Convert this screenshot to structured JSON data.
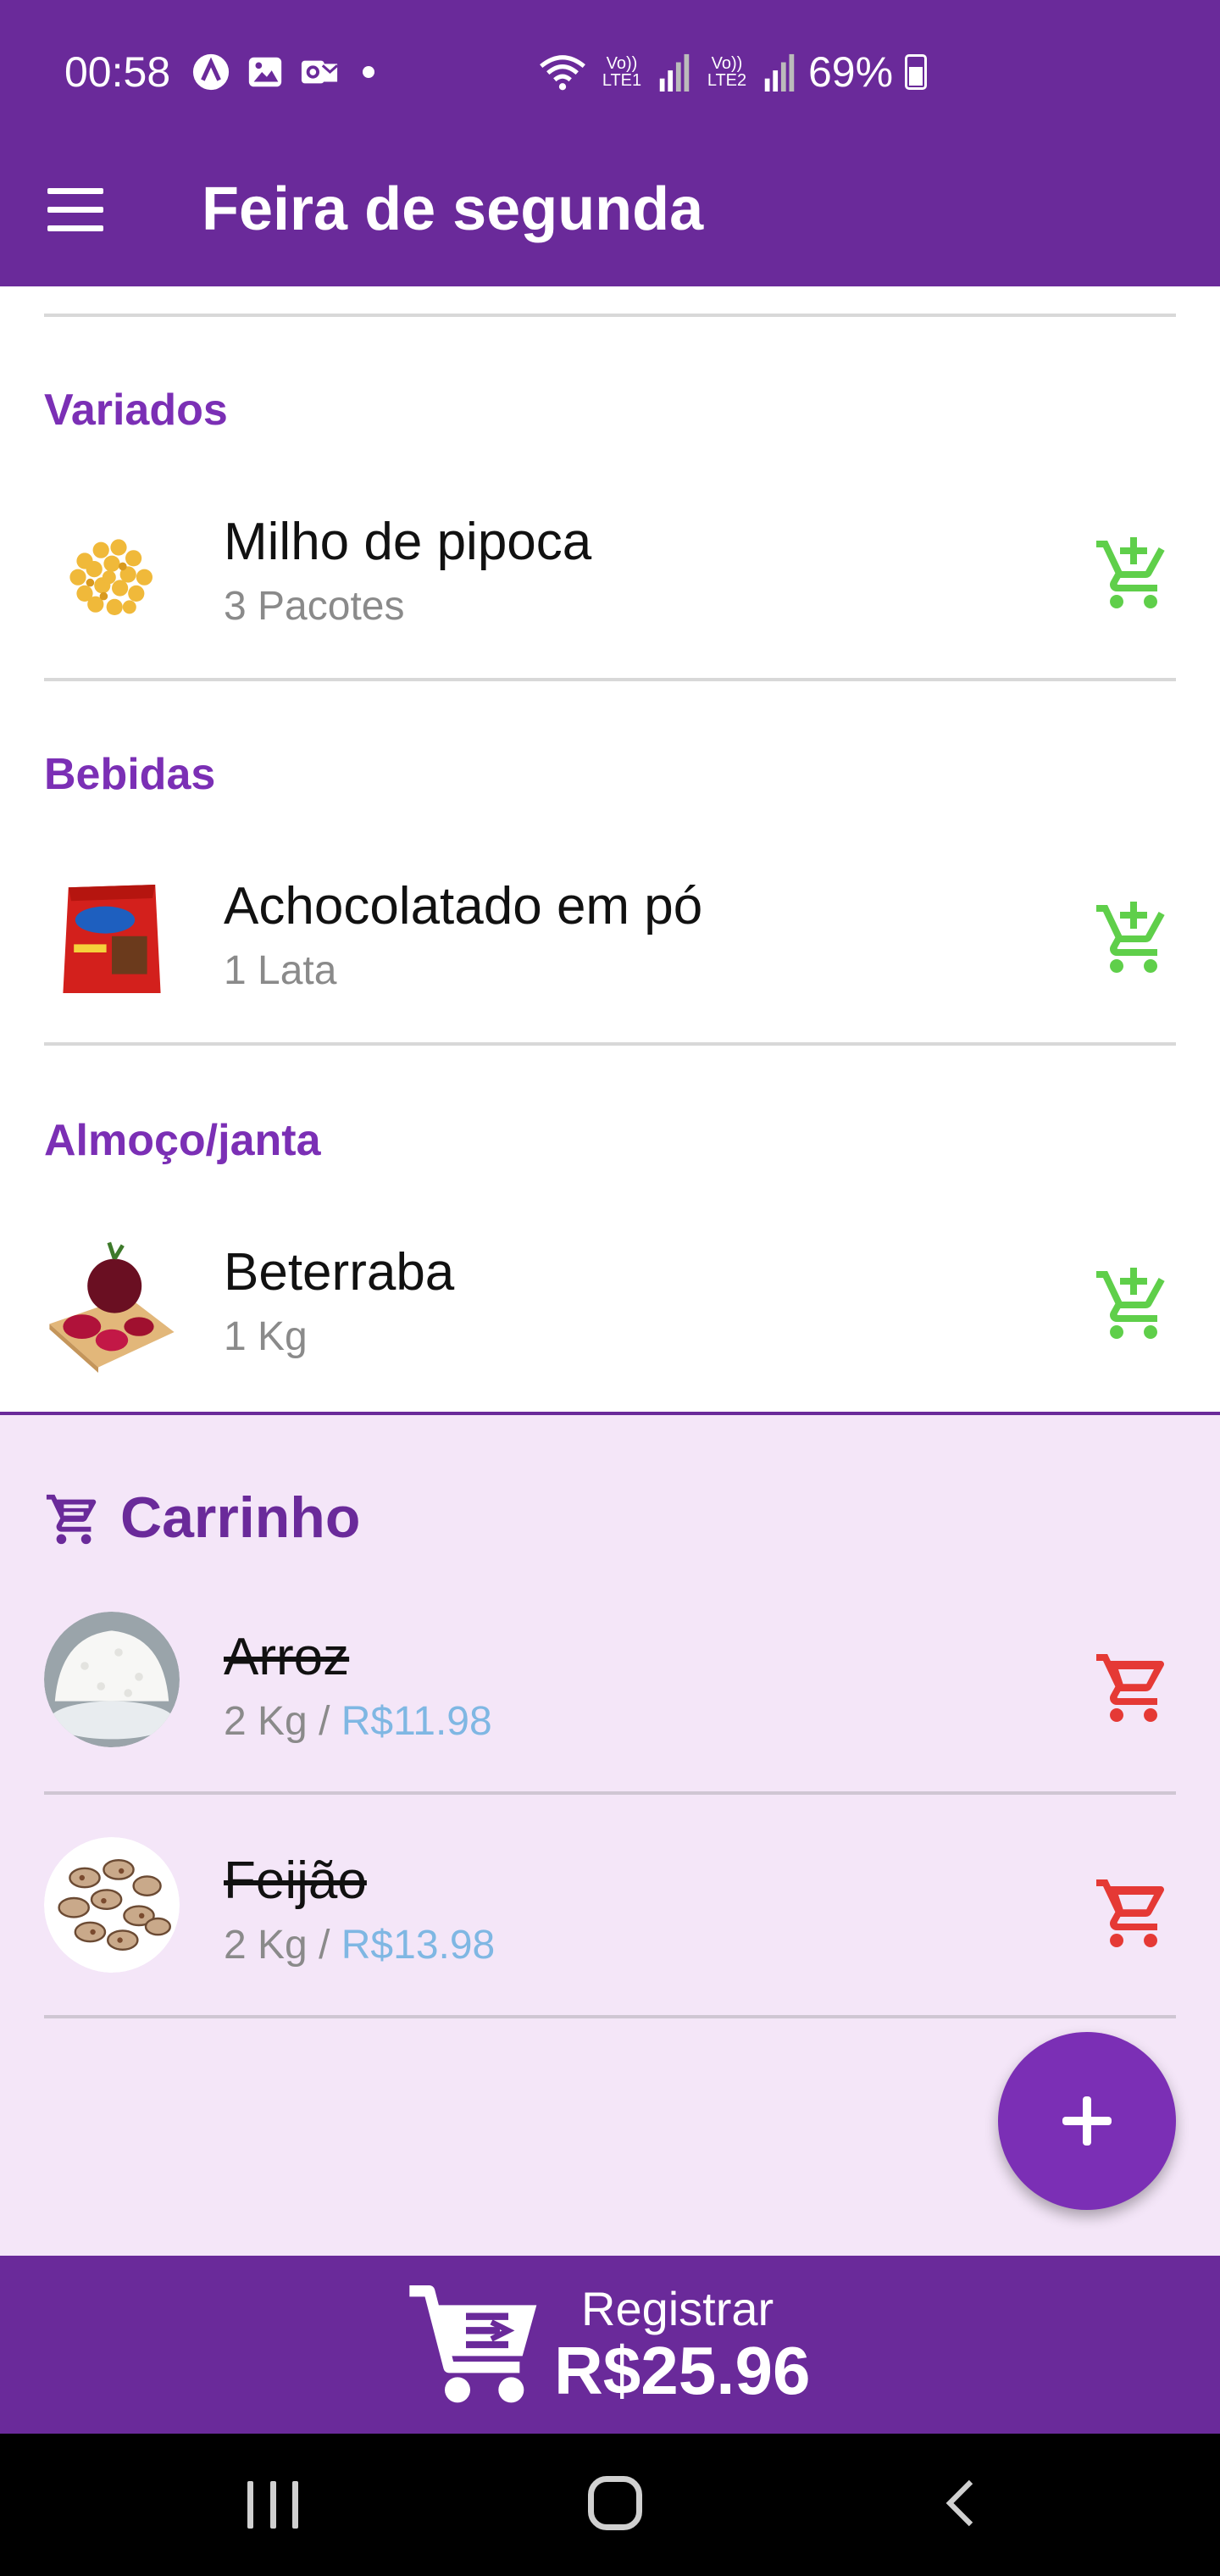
{
  "status_bar": {
    "time": "00:58",
    "sim1": "Vo)) LTE1",
    "sim2": "Vo)) LTE2",
    "battery": "69%"
  },
  "app_bar": {
    "title": "Feira de segunda"
  },
  "sections": [
    {
      "title": "Variados",
      "items": [
        {
          "name": "Milho de pipoca",
          "quantity": "3 Pacotes",
          "image": "popcorn-kernels"
        }
      ]
    },
    {
      "title": "Bebidas",
      "items": [
        {
          "name": "Achocolatado em pó",
          "quantity": "1 Lata",
          "image": "chocolate-powder-pack"
        }
      ]
    },
    {
      "title": "Almoço/janta",
      "items": [
        {
          "name": "Beterraba",
          "quantity": "1 Kg",
          "image": "beetroot"
        }
      ]
    }
  ],
  "cart": {
    "title": "Carrinho",
    "items": [
      {
        "name": "Arroz",
        "quantity": "2 Kg",
        "separator": " / ",
        "price": "R$11.98",
        "image": "rice-bowl"
      },
      {
        "name": "Feijão",
        "quantity": "2 Kg",
        "separator": " / ",
        "price": "R$13.98",
        "image": "beans"
      }
    ]
  },
  "register": {
    "label": "Registrar",
    "total": "R$25.96"
  },
  "colors": {
    "primary": "#6a2a9a",
    "accent": "#7b2fb5",
    "add_cart": "#5fcf4a",
    "remove_cart": "#e53935",
    "cart_bg": "#f4e6f8",
    "price": "#7fb7e3"
  }
}
